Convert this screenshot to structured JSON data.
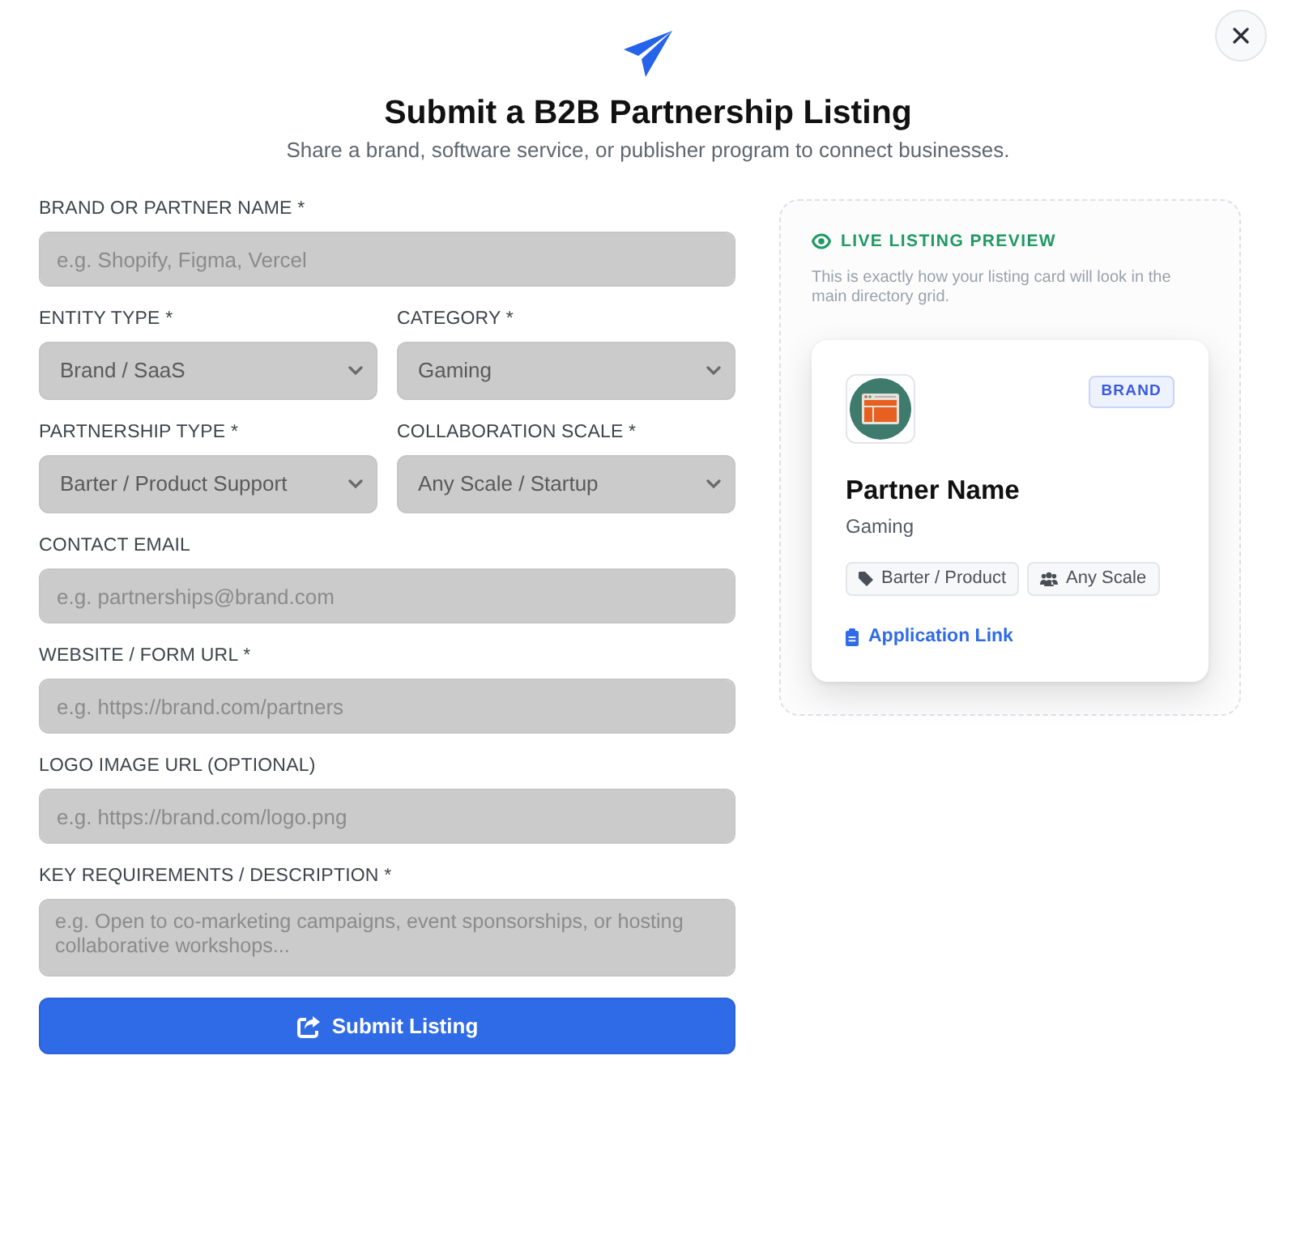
{
  "header": {
    "title": "Submit a B2B Partnership Listing",
    "subtitle": "Share a brand, software service, or publisher program to connect businesses."
  },
  "form": {
    "rows": [
      [
        {
          "kind": "input",
          "label": "BRAND OR PARTNER NAME *",
          "placeholder": "e.g. Shopify, Figma, Vercel"
        }
      ],
      [
        {
          "kind": "select",
          "label": "ENTITY TYPE *",
          "value": "Brand / SaaS"
        },
        {
          "kind": "select",
          "label": "CATEGORY *",
          "value": "Gaming"
        }
      ],
      [
        {
          "kind": "select",
          "label": "PARTNERSHIP TYPE *",
          "value": "Barter / Product Support"
        },
        {
          "kind": "select",
          "label": "COLLABORATION SCALE *",
          "value": "Any Scale / Startup"
        }
      ],
      [
        {
          "kind": "input",
          "label": "CONTACT EMAIL",
          "placeholder": "e.g. partnerships@brand.com"
        }
      ],
      [
        {
          "kind": "input",
          "label": "WEBSITE / FORM URL *",
          "placeholder": "e.g. https://brand.com/partners"
        }
      ],
      [
        {
          "kind": "input",
          "label": "LOGO IMAGE URL (OPTIONAL)",
          "placeholder": "e.g. https://brand.com/logo.png"
        }
      ],
      [
        {
          "kind": "textarea",
          "label": "KEY REQUIREMENTS / DESCRIPTION *",
          "placeholder": "e.g. Open to co-marketing campaigns, event sponsorships, or hosting collaborative workshops..."
        }
      ]
    ],
    "submit": {
      "label": "Submit Listing"
    }
  },
  "preview": {
    "heading": "LIVE LISTING PREVIEW",
    "description": "This is exactly how your listing card will look in the main directory grid.",
    "card": {
      "badge": "BRAND",
      "name": "Partner Name",
      "category": "Gaming",
      "tags": [
        {
          "kind": "partnership",
          "label": "Barter / Product"
        },
        {
          "kind": "scale",
          "label": "Any Scale"
        }
      ],
      "link": "Application Link"
    }
  }
}
